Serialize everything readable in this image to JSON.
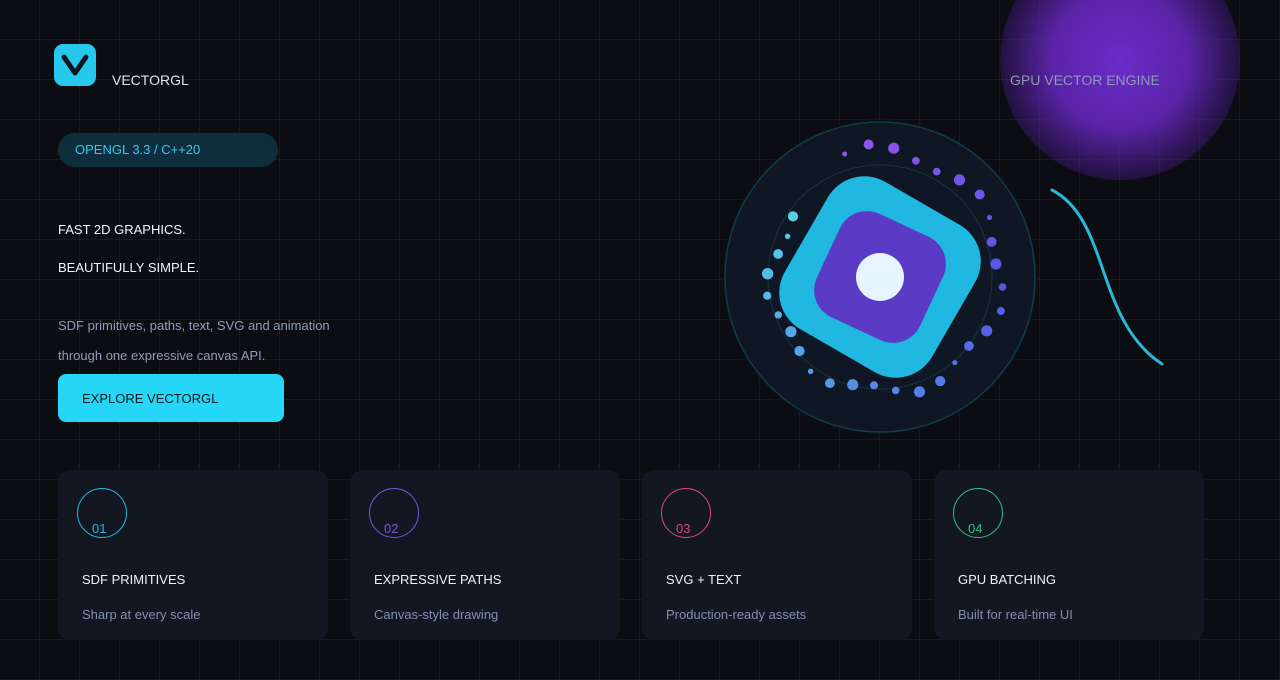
{
  "brand": {
    "name": "VECTORGL",
    "logo_icon": "v-logo-icon",
    "logo_color": "#26c8ec"
  },
  "header": {
    "tagline": "GPU VECTOR ENGINE"
  },
  "hero": {
    "pill": "OPENGL 3.3 / C++20",
    "headline_1": "FAST 2D GRAPHICS.",
    "headline_2": "BEAUTIFULLY SIMPLE.",
    "desc_1": "SDF primitives, paths, text, SVG and animation",
    "desc_2": "through one expressive canvas API.",
    "cta": "EXPLORE VECTORGL"
  },
  "colors": {
    "accent": "#25d6f6",
    "purple": "#6b3fd0",
    "pink": "#e2457f",
    "green": "#2fc47f",
    "background": "#0b0d12"
  },
  "features": [
    {
      "num": "01",
      "title": "SDF PRIMITIVES",
      "sub": "Sharp at every scale",
      "color": "#26bde0"
    },
    {
      "num": "02",
      "title": "EXPRESSIVE PATHS",
      "sub": "Canvas-style drawing",
      "color": "#7a55e0"
    },
    {
      "num": "03",
      "title": "SVG + TEXT",
      "sub": "Production-ready assets",
      "color": "#e2457f"
    },
    {
      "num": "04",
      "title": "GPU BATCHING",
      "sub": "Built for real-time UI",
      "color": "#2fc47f"
    }
  ]
}
